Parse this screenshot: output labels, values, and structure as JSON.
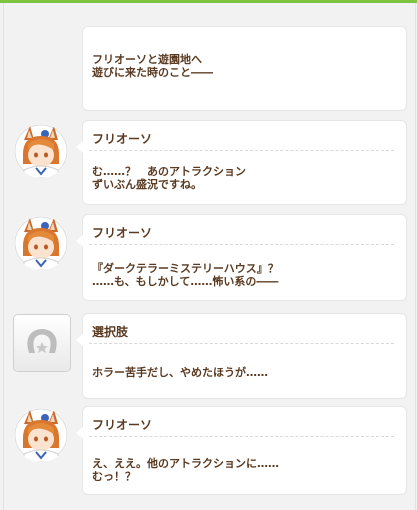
{
  "intro": {
    "text": "フリオーソと遊園地へ\n遊びに来た時のこと――"
  },
  "messages": [
    {
      "speaker": "フリオーソ",
      "text": "む……？　あのアトラクション\nずいぶん盛況ですね。"
    },
    {
      "speaker": "フリオーソ",
      "text": "『ダークテラーミステリーハウス』？\n……も、もしかして……怖い系の――"
    },
    {
      "speaker": "選択肢",
      "text": "ホラー苦手だし、やめたほうが……"
    },
    {
      "speaker": "フリオーソ",
      "text": "え、ええ。他のアトラクションに……\nむっ！？"
    }
  ],
  "icons": {
    "character_avatar": "horse-girl-portrait-icon",
    "choice_avatar": "horseshoe-star-icon"
  },
  "colors": {
    "accent": "#7cc441",
    "text": "#5a3a21",
    "bubble": "#ffffff",
    "background": "#f2f2f2"
  }
}
